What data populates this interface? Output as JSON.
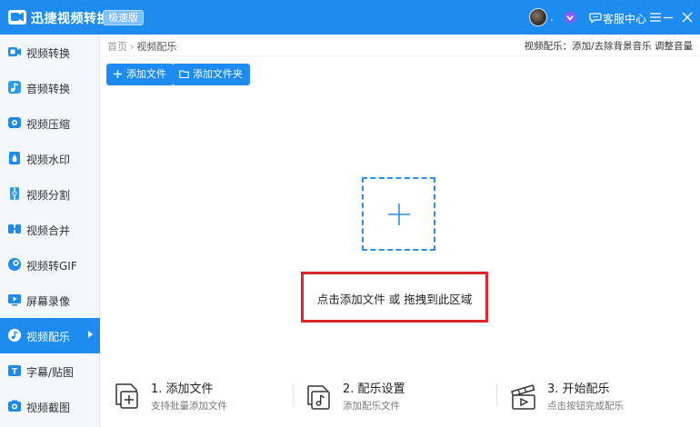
{
  "app": {
    "title": "迅捷视频转换器",
    "edition": "极速版",
    "avatar_suffix": ".",
    "service_label": "客服中心"
  },
  "window_controls": [
    "menu-icon",
    "minimize-icon",
    "close-icon"
  ],
  "sidebar": {
    "items": [
      {
        "label": "视频转换",
        "icon": "video-convert-icon",
        "active": false
      },
      {
        "label": "音频转换",
        "icon": "audio-convert-icon",
        "active": false
      },
      {
        "label": "视频压缩",
        "icon": "video-compress-icon",
        "active": false
      },
      {
        "label": "视频水印",
        "icon": "video-watermark-icon",
        "active": false
      },
      {
        "label": "视频分割",
        "icon": "video-split-icon",
        "active": false
      },
      {
        "label": "视频合并",
        "icon": "video-merge-icon",
        "active": false
      },
      {
        "label": "视频转GIF",
        "icon": "video-gif-icon",
        "active": false
      },
      {
        "label": "屏幕录像",
        "icon": "screen-record-icon",
        "active": false
      },
      {
        "label": "视频配乐",
        "icon": "video-music-icon",
        "active": true
      },
      {
        "label": "字幕/贴图",
        "icon": "subtitle-sticker-icon",
        "active": false
      },
      {
        "label": "视频截图",
        "icon": "video-screenshot-icon",
        "active": false
      }
    ]
  },
  "breadcrumb": {
    "home": "首页",
    "separator": "›",
    "current": "视频配乐"
  },
  "page_hint": "视频配乐：添加/去除背景音乐 调整音量",
  "toolbar": {
    "add_file": "添加文件",
    "add_folder": "添加文件夹"
  },
  "drop_zone": {
    "hint": "点击添加文件 或 拖拽到此区域"
  },
  "steps": [
    {
      "title": "1. 添加文件",
      "desc": "支持批量添加文件",
      "icon": "add-file-icon"
    },
    {
      "title": "2. 配乐设置",
      "desc": "添加配乐文件",
      "icon": "music-file-icon"
    },
    {
      "title": "3. 开始配乐",
      "desc": "点击按钮完成配乐",
      "icon": "play-clapper-icon"
    }
  ],
  "colors": {
    "accent": "#1e8bf0",
    "highlight_border": "#e0262a",
    "sidebar_bg": "#f4f7fb"
  }
}
